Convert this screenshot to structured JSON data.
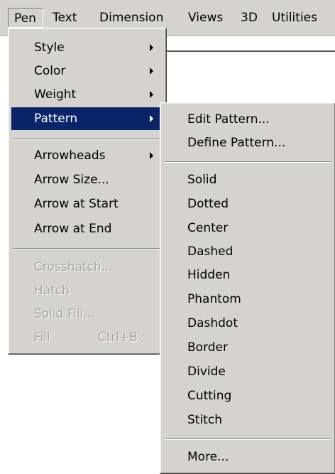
{
  "menubar": {
    "items": [
      "Pen",
      "Text",
      "Dimension",
      "Views",
      "3D",
      "Utilities"
    ]
  },
  "pen_menu": {
    "items": [
      {
        "label": "Style",
        "submenu": true
      },
      {
        "label": "Color",
        "submenu": true
      },
      {
        "label": "Weight",
        "submenu": true
      },
      {
        "label": "Pattern",
        "submenu": true,
        "selected": true
      },
      {
        "label": "Arrowheads",
        "submenu": true
      },
      {
        "label": "Arrow Size..."
      },
      {
        "label": "Arrow at Start"
      },
      {
        "label": "Arrow at End"
      },
      {
        "label": "Crosshatch...",
        "disabled": true
      },
      {
        "label": "Hatch",
        "disabled": true
      },
      {
        "label": "Solid Fill...",
        "disabled": true
      },
      {
        "label": "Fill",
        "shortcut": "Ctrl+B",
        "disabled": true
      }
    ]
  },
  "pattern_menu": {
    "items": [
      "Edit Pattern...",
      "Define Pattern...",
      "Solid",
      "Dotted",
      "Center",
      "Dashed",
      "Hidden",
      "Phantom",
      "Dashdot",
      "Border",
      "Divide",
      "Cutting",
      "Stitch",
      "More..."
    ]
  },
  "colors": {
    "menu_bg": "#d6d3ce",
    "highlight": "#0a246a",
    "disabled_text": "#a8a59f"
  }
}
